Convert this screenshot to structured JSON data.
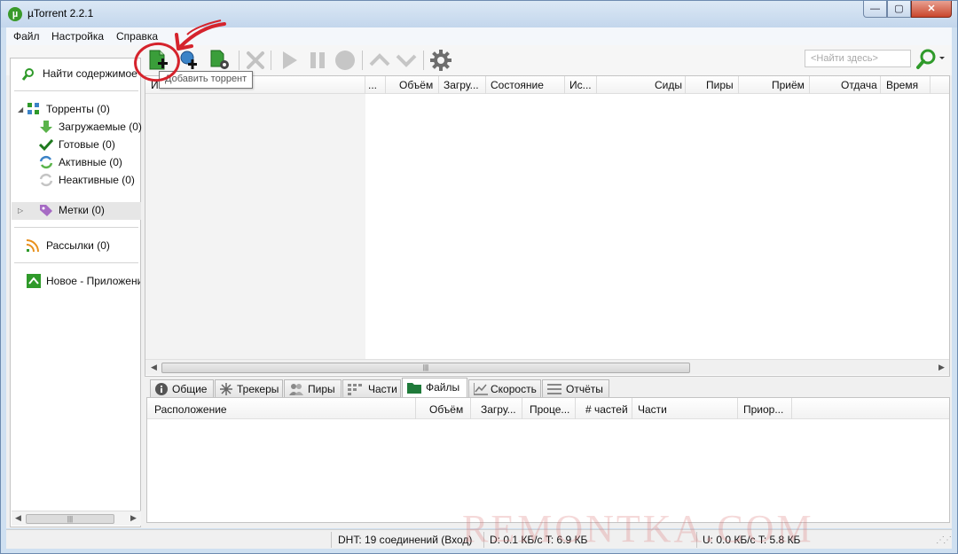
{
  "window": {
    "title": "µTorrent 2.2.1",
    "app_icon_letter": "µ",
    "controls": {
      "minimize": "—",
      "maximize": "▢",
      "close": "✕"
    }
  },
  "menu": {
    "items": [
      "Файл",
      "Настройка",
      "Справка"
    ]
  },
  "toolbar": {
    "buttons": [
      {
        "name": "add-torrent",
        "icon": "add-torrent-icon",
        "enabled": true
      },
      {
        "name": "add-torrent-from-url",
        "icon": "add-url-icon",
        "enabled": true
      },
      {
        "name": "create-torrent",
        "icon": "create-torrent-icon",
        "enabled": true
      },
      {
        "name": "remove",
        "icon": "remove-x-icon",
        "enabled": false
      },
      {
        "name": "start",
        "icon": "play-icon",
        "enabled": false
      },
      {
        "name": "pause",
        "icon": "pause-icon",
        "enabled": false
      },
      {
        "name": "stop",
        "icon": "stop-icon",
        "enabled": false
      },
      {
        "name": "move-up",
        "icon": "arrow-up-icon",
        "enabled": false
      },
      {
        "name": "move-down",
        "icon": "arrow-down-icon",
        "enabled": false
      },
      {
        "name": "settings",
        "icon": "gear-icon",
        "enabled": true
      }
    ],
    "search_placeholder": "<Найти здесь>",
    "tooltip": "Добавить торрент"
  },
  "sidebar": {
    "find_label": "Найти содержимое",
    "torrents": "Торренты (0)",
    "downloading": "Загружаемые (0)",
    "completed": "Готовые (0)",
    "active": "Активные (0)",
    "inactive": "Неактивные (0)",
    "labels": "Метки (0)",
    "feeds": "Рассылки (0)",
    "new_app": "Новое - Приложения"
  },
  "list": {
    "columns": [
      "Имя",
      "...",
      "Объём",
      "Загру...",
      "Состояние",
      "Ис...",
      "Сиды",
      "Пиры",
      "Приём",
      "Отдача",
      "Время"
    ]
  },
  "tabs": {
    "items": [
      "Общие",
      "Трекеры",
      "Пиры",
      "Части",
      "Файлы",
      "Скорость",
      "Отчёты"
    ],
    "active": "Файлы"
  },
  "files": {
    "columns": [
      "Расположение",
      "Объём",
      "Загру...",
      "Проце...",
      "# частей",
      "Части",
      "Приор..."
    ]
  },
  "status": {
    "dht": "DHT: 19 соединений (Вход)",
    "download": "D: 0.1 КБ/с T: 6.9 КБ",
    "upload": "U: 0.0 КБ/с T: 5.8 КБ"
  },
  "watermark": "REMONTKA.COM",
  "colors": {
    "accent_green": "#2f9a2a",
    "annotation_red": "#d5232c",
    "close_red": "#c9462c"
  }
}
